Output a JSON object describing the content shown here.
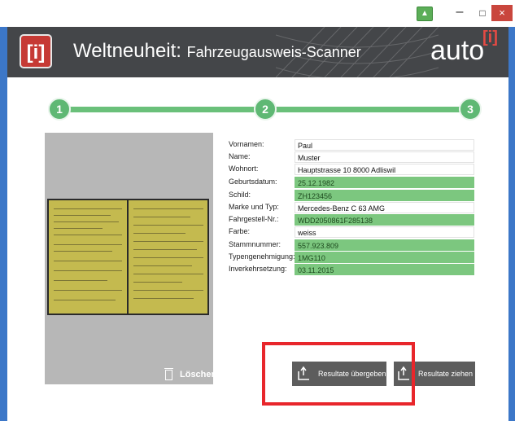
{
  "window": {
    "controls": {
      "minimize": "–",
      "maximize": "□",
      "close": "×"
    }
  },
  "header": {
    "logo_text": "[i]",
    "title": "Weltneuheit:",
    "subtitle": "Fahrzeugausweis-Scanner",
    "brand": "auto",
    "brand_mark": "[i]"
  },
  "steps": [
    "1",
    "2",
    "3"
  ],
  "scan": {
    "delete_label": "Löschen"
  },
  "fields": [
    {
      "label": "Vornamen:",
      "value": "Paul",
      "highlight": false
    },
    {
      "label": "Name:",
      "value": "Muster",
      "highlight": false
    },
    {
      "label": "Wohnort:",
      "value": "Hauptstrasse 10  8000 Adliswil",
      "highlight": false
    },
    {
      "label": "Geburtsdatum:",
      "value": "25.12.1982",
      "highlight": true
    },
    {
      "label": "Schild:",
      "value": "ZH123456",
      "highlight": true
    },
    {
      "label": "Marke und Typ:",
      "value": "Mercedes-Benz C 63 AMG",
      "highlight": false
    },
    {
      "label": "Fahrgestell-Nr.:",
      "value": "WDD2050861F285138",
      "highlight": true
    },
    {
      "label": "Farbe:",
      "value": "weiss",
      "highlight": false
    },
    {
      "label": "Stammnummer:",
      "value": "557.923.809",
      "highlight": true
    },
    {
      "label": "Typengenehmigung:",
      "value": "1MG110",
      "highlight": true
    },
    {
      "label": "Inverkehrsetzung:",
      "value": "03.11.2015",
      "highlight": true
    }
  ],
  "actions": {
    "submit_label": "Resultate übergeben",
    "pull_label": "Resultate ziehen"
  },
  "colors": {
    "accent_green": "#5fb874",
    "field_highlight": "#7cc77f",
    "header_bg": "#444649",
    "annotation_red": "#e8262b"
  }
}
